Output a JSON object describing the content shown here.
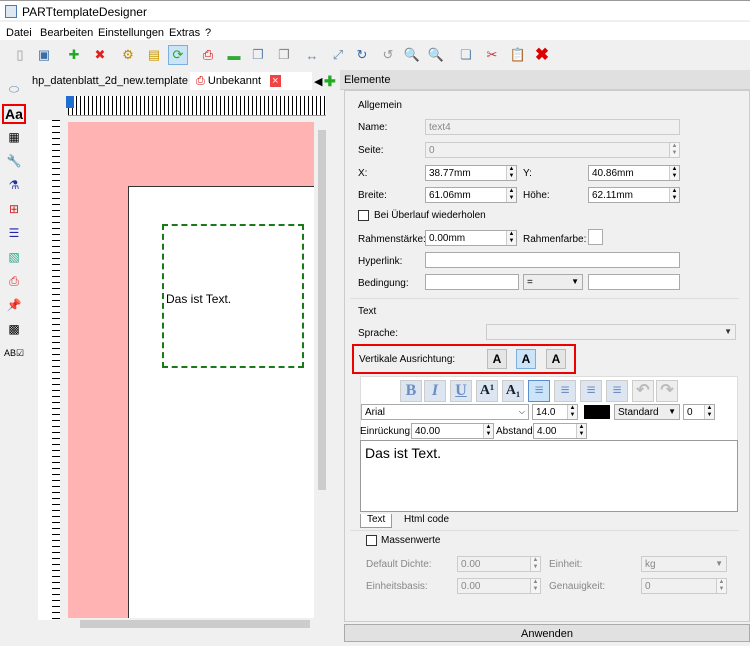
{
  "window": {
    "title": "PARTtemplateDesigner"
  },
  "menu": [
    "Datei",
    "Bearbeiten",
    "Einstellungen",
    "Extras",
    "?"
  ],
  "tabs": [
    {
      "label": "hp_datenblatt_2d_new.template"
    },
    {
      "label": "Unbekannt"
    }
  ],
  "panel": {
    "title": "Elemente",
    "allgemein": {
      "title": "Allgemein",
      "name_label": "Name:",
      "name": "text4",
      "seite_label": "Seite:",
      "seite": "0",
      "x_label": "X:",
      "x": "38.77mm",
      "y_label": "Y:",
      "y": "40.86mm",
      "breite_label": "Breite:",
      "breite": "61.06mm",
      "hoehe_label": "Höhe:",
      "hoehe": "62.11mm",
      "overflow_label": "Bei Überlauf wiederholen",
      "rahmen_label": "Rahmenstärke:",
      "rahmen": "0.00mm",
      "rahmenfarbe_label": "Rahmenfarbe:",
      "hyperlink_label": "Hyperlink:",
      "bedingung_label": "Bedingung:",
      "operator": "="
    },
    "text": {
      "title": "Text",
      "sprache_label": "Sprache:",
      "valign_label": "Vertikale Ausrichtung:",
      "valign_selected": "middle",
      "font": "Arial",
      "size": "14.0",
      "color": "#000000",
      "style": "Standard",
      "spacing": "0",
      "einrueckung_label": "Einrückung:",
      "einrueckung": "40.00",
      "abstand_label": "Abstand:",
      "abstand": "4.00",
      "content": "Das ist Text.",
      "subtabs": [
        "Text",
        "Html code"
      ]
    },
    "masse": {
      "label": "Massenwerte",
      "dichte_label": "Default Dichte:",
      "dichte": "0.00",
      "einheit_label": "Einheit:",
      "einheit": "kg",
      "basis_label": "Einheitsbasis:",
      "basis": "0.00",
      "genauigkeit_label": "Genauigkeit:",
      "genauigkeit": "0"
    },
    "apply": "Anwenden"
  },
  "canvas": {
    "text": "Das ist Text."
  }
}
